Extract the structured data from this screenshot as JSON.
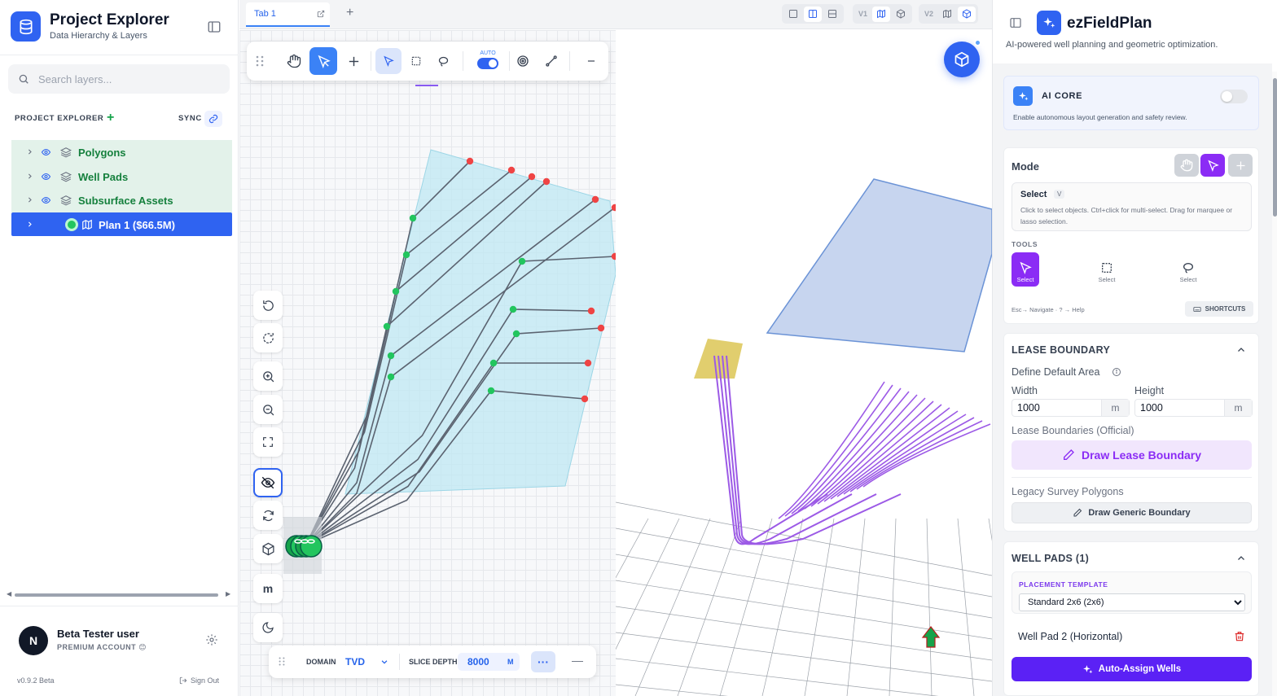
{
  "left_panel": {
    "title": "Project Explorer",
    "subtitle": "Data Hierarchy & Layers",
    "search_placeholder": "Search layers...",
    "explorer_label": "PROJECT EXPLORER",
    "sync_label": "SYNC",
    "tree": [
      {
        "label": "Polygons",
        "visible": true
      },
      {
        "label": "Well Pads",
        "visible": true
      },
      {
        "label": "Subsurface Assets",
        "visible": true
      },
      {
        "label": "Plan 1 ($66.5M)",
        "selected": true
      }
    ],
    "user_name": "Beta Tester user",
    "user_initial": "N",
    "user_tier": "PREMIUM ACCOUNT 😊",
    "version": "v0.9.2 Beta",
    "sign_out": "Sign Out"
  },
  "tabs": [
    {
      "label": "Tab 1"
    }
  ],
  "view_controls": {
    "v1_label": "V1",
    "v2_label": "V2"
  },
  "toolbar": {
    "auto_label": "AUTO",
    "auto_on": true
  },
  "side_tools": {
    "units_label": "m"
  },
  "bottom_bar": {
    "domain_label": "DOMAIN",
    "domain_value": "TVD",
    "slice_label": "SLICE DEPTH",
    "slice_value": "8000",
    "slice_unit": "M",
    "more_label": "···",
    "minimize_label": "—"
  },
  "right_panel": {
    "title": "ezFieldPlan",
    "subtitle": "AI-powered well planning and geometric optimization.",
    "ai_core": {
      "title": "AI CORE",
      "desc": "Enable autonomous layout generation and safety review.",
      "enabled": false
    },
    "mode": {
      "title": "Mode",
      "current": "Select",
      "key": "V",
      "desc": "Click to select objects. Ctrl+click for multi-select. Drag for marquee or lasso selection.",
      "tools_label": "TOOLS",
      "tools": [
        "Select",
        "Select",
        "Select"
      ],
      "help": "Esc→ Navigate · ? → Help",
      "shortcuts": "SHORTCUTS"
    },
    "lease": {
      "title": "LEASE BOUNDARY",
      "define": "Define Default Area",
      "width_label": "Width",
      "height_label": "Height",
      "width_value": "1000",
      "height_value": "1000",
      "unit": "m",
      "official": "Lease Boundaries (Official)",
      "draw_lease": "Draw Lease Boundary",
      "legacy": "Legacy Survey Polygons",
      "draw_generic": "Draw Generic Boundary"
    },
    "pads": {
      "title": "WELL PADS (1)",
      "template_label": "PLACEMENT TEMPLATE",
      "template_value": "Standard 2x6 (2x6)",
      "pad_name": "Well Pad 2 (Horizontal)",
      "auto_assign": "Auto-Assign Wells"
    }
  },
  "colors": {
    "accent": "#2f63f1",
    "purple": "#8b2cf5",
    "green": "#15803d",
    "tree_bg": "#e3f2ea"
  }
}
